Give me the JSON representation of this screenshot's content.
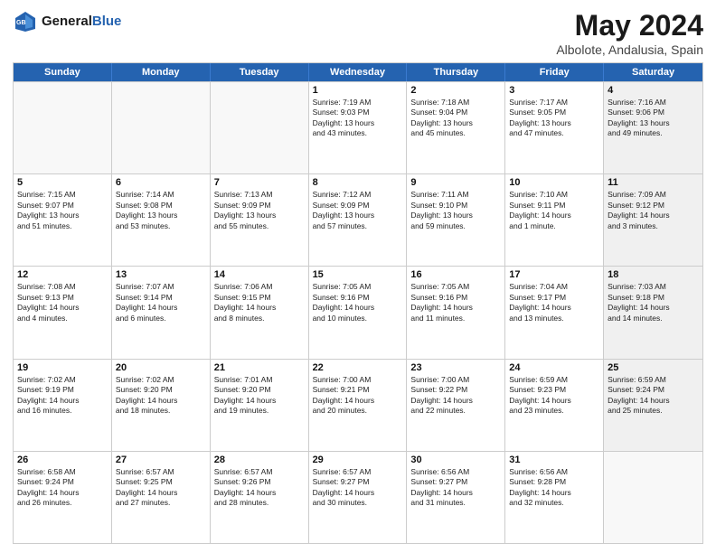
{
  "header": {
    "logo_general": "General",
    "logo_blue": "Blue",
    "month_year": "May 2024",
    "location": "Albolote, Andalusia, Spain"
  },
  "weekdays": [
    "Sunday",
    "Monday",
    "Tuesday",
    "Wednesday",
    "Thursday",
    "Friday",
    "Saturday"
  ],
  "rows": [
    [
      {
        "day": "",
        "lines": [],
        "shaded": false,
        "empty": true
      },
      {
        "day": "",
        "lines": [],
        "shaded": false,
        "empty": true
      },
      {
        "day": "",
        "lines": [],
        "shaded": false,
        "empty": true
      },
      {
        "day": "1",
        "lines": [
          "Sunrise: 7:19 AM",
          "Sunset: 9:03 PM",
          "Daylight: 13 hours",
          "and 43 minutes."
        ],
        "shaded": false,
        "empty": false
      },
      {
        "day": "2",
        "lines": [
          "Sunrise: 7:18 AM",
          "Sunset: 9:04 PM",
          "Daylight: 13 hours",
          "and 45 minutes."
        ],
        "shaded": false,
        "empty": false
      },
      {
        "day": "3",
        "lines": [
          "Sunrise: 7:17 AM",
          "Sunset: 9:05 PM",
          "Daylight: 13 hours",
          "and 47 minutes."
        ],
        "shaded": false,
        "empty": false
      },
      {
        "day": "4",
        "lines": [
          "Sunrise: 7:16 AM",
          "Sunset: 9:06 PM",
          "Daylight: 13 hours",
          "and 49 minutes."
        ],
        "shaded": true,
        "empty": false
      }
    ],
    [
      {
        "day": "5",
        "lines": [
          "Sunrise: 7:15 AM",
          "Sunset: 9:07 PM",
          "Daylight: 13 hours",
          "and 51 minutes."
        ],
        "shaded": false,
        "empty": false
      },
      {
        "day": "6",
        "lines": [
          "Sunrise: 7:14 AM",
          "Sunset: 9:08 PM",
          "Daylight: 13 hours",
          "and 53 minutes."
        ],
        "shaded": false,
        "empty": false
      },
      {
        "day": "7",
        "lines": [
          "Sunrise: 7:13 AM",
          "Sunset: 9:09 PM",
          "Daylight: 13 hours",
          "and 55 minutes."
        ],
        "shaded": false,
        "empty": false
      },
      {
        "day": "8",
        "lines": [
          "Sunrise: 7:12 AM",
          "Sunset: 9:09 PM",
          "Daylight: 13 hours",
          "and 57 minutes."
        ],
        "shaded": false,
        "empty": false
      },
      {
        "day": "9",
        "lines": [
          "Sunrise: 7:11 AM",
          "Sunset: 9:10 PM",
          "Daylight: 13 hours",
          "and 59 minutes."
        ],
        "shaded": false,
        "empty": false
      },
      {
        "day": "10",
        "lines": [
          "Sunrise: 7:10 AM",
          "Sunset: 9:11 PM",
          "Daylight: 14 hours",
          "and 1 minute."
        ],
        "shaded": false,
        "empty": false
      },
      {
        "day": "11",
        "lines": [
          "Sunrise: 7:09 AM",
          "Sunset: 9:12 PM",
          "Daylight: 14 hours",
          "and 3 minutes."
        ],
        "shaded": true,
        "empty": false
      }
    ],
    [
      {
        "day": "12",
        "lines": [
          "Sunrise: 7:08 AM",
          "Sunset: 9:13 PM",
          "Daylight: 14 hours",
          "and 4 minutes."
        ],
        "shaded": false,
        "empty": false
      },
      {
        "day": "13",
        "lines": [
          "Sunrise: 7:07 AM",
          "Sunset: 9:14 PM",
          "Daylight: 14 hours",
          "and 6 minutes."
        ],
        "shaded": false,
        "empty": false
      },
      {
        "day": "14",
        "lines": [
          "Sunrise: 7:06 AM",
          "Sunset: 9:15 PM",
          "Daylight: 14 hours",
          "and 8 minutes."
        ],
        "shaded": false,
        "empty": false
      },
      {
        "day": "15",
        "lines": [
          "Sunrise: 7:05 AM",
          "Sunset: 9:16 PM",
          "Daylight: 14 hours",
          "and 10 minutes."
        ],
        "shaded": false,
        "empty": false
      },
      {
        "day": "16",
        "lines": [
          "Sunrise: 7:05 AM",
          "Sunset: 9:16 PM",
          "Daylight: 14 hours",
          "and 11 minutes."
        ],
        "shaded": false,
        "empty": false
      },
      {
        "day": "17",
        "lines": [
          "Sunrise: 7:04 AM",
          "Sunset: 9:17 PM",
          "Daylight: 14 hours",
          "and 13 minutes."
        ],
        "shaded": false,
        "empty": false
      },
      {
        "day": "18",
        "lines": [
          "Sunrise: 7:03 AM",
          "Sunset: 9:18 PM",
          "Daylight: 14 hours",
          "and 14 minutes."
        ],
        "shaded": true,
        "empty": false
      }
    ],
    [
      {
        "day": "19",
        "lines": [
          "Sunrise: 7:02 AM",
          "Sunset: 9:19 PM",
          "Daylight: 14 hours",
          "and 16 minutes."
        ],
        "shaded": false,
        "empty": false
      },
      {
        "day": "20",
        "lines": [
          "Sunrise: 7:02 AM",
          "Sunset: 9:20 PM",
          "Daylight: 14 hours",
          "and 18 minutes."
        ],
        "shaded": false,
        "empty": false
      },
      {
        "day": "21",
        "lines": [
          "Sunrise: 7:01 AM",
          "Sunset: 9:20 PM",
          "Daylight: 14 hours",
          "and 19 minutes."
        ],
        "shaded": false,
        "empty": false
      },
      {
        "day": "22",
        "lines": [
          "Sunrise: 7:00 AM",
          "Sunset: 9:21 PM",
          "Daylight: 14 hours",
          "and 20 minutes."
        ],
        "shaded": false,
        "empty": false
      },
      {
        "day": "23",
        "lines": [
          "Sunrise: 7:00 AM",
          "Sunset: 9:22 PM",
          "Daylight: 14 hours",
          "and 22 minutes."
        ],
        "shaded": false,
        "empty": false
      },
      {
        "day": "24",
        "lines": [
          "Sunrise: 6:59 AM",
          "Sunset: 9:23 PM",
          "Daylight: 14 hours",
          "and 23 minutes."
        ],
        "shaded": false,
        "empty": false
      },
      {
        "day": "25",
        "lines": [
          "Sunrise: 6:59 AM",
          "Sunset: 9:24 PM",
          "Daylight: 14 hours",
          "and 25 minutes."
        ],
        "shaded": true,
        "empty": false
      }
    ],
    [
      {
        "day": "26",
        "lines": [
          "Sunrise: 6:58 AM",
          "Sunset: 9:24 PM",
          "Daylight: 14 hours",
          "and 26 minutes."
        ],
        "shaded": false,
        "empty": false
      },
      {
        "day": "27",
        "lines": [
          "Sunrise: 6:57 AM",
          "Sunset: 9:25 PM",
          "Daylight: 14 hours",
          "and 27 minutes."
        ],
        "shaded": false,
        "empty": false
      },
      {
        "day": "28",
        "lines": [
          "Sunrise: 6:57 AM",
          "Sunset: 9:26 PM",
          "Daylight: 14 hours",
          "and 28 minutes."
        ],
        "shaded": false,
        "empty": false
      },
      {
        "day": "29",
        "lines": [
          "Sunrise: 6:57 AM",
          "Sunset: 9:27 PM",
          "Daylight: 14 hours",
          "and 30 minutes."
        ],
        "shaded": false,
        "empty": false
      },
      {
        "day": "30",
        "lines": [
          "Sunrise: 6:56 AM",
          "Sunset: 9:27 PM",
          "Daylight: 14 hours",
          "and 31 minutes."
        ],
        "shaded": false,
        "empty": false
      },
      {
        "day": "31",
        "lines": [
          "Sunrise: 6:56 AM",
          "Sunset: 9:28 PM",
          "Daylight: 14 hours",
          "and 32 minutes."
        ],
        "shaded": false,
        "empty": false
      },
      {
        "day": "",
        "lines": [],
        "shaded": true,
        "empty": true
      }
    ]
  ]
}
